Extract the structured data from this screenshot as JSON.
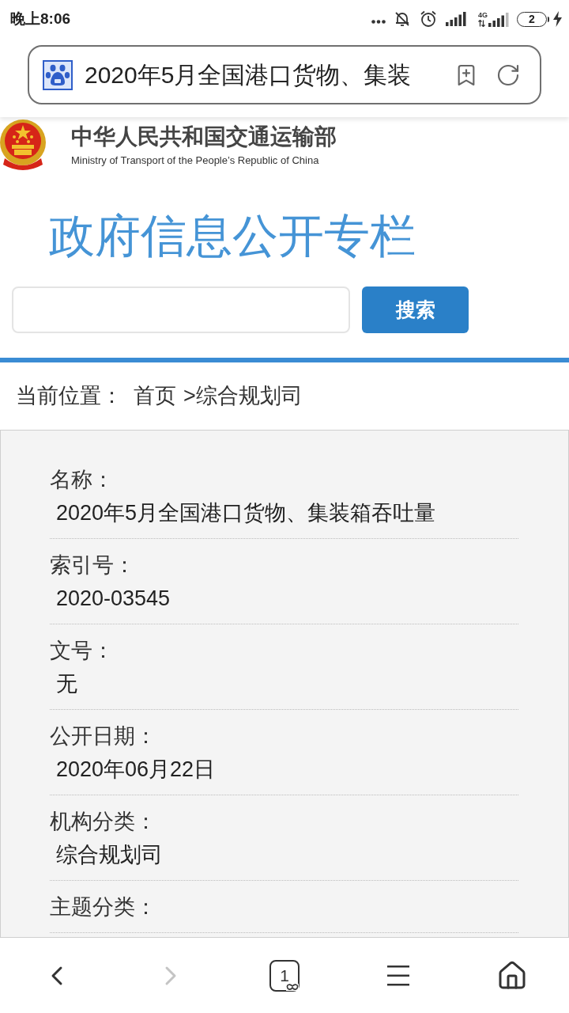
{
  "status_bar": {
    "time": "晚上8:06",
    "network_type": "4G",
    "battery": "2",
    "charging": true
  },
  "address_bar": {
    "title": "2020年5月全国港口货物、集装"
  },
  "site_header": {
    "title": "中华人民共和国交通运输部",
    "subtitle": "Ministry of Transport of the People’s Republic of China"
  },
  "section_title": "政府信息公开专栏",
  "search": {
    "button": "搜索"
  },
  "breadcrumb": {
    "label": "当前位置：",
    "items": [
      "首页",
      "综合规划司"
    ],
    "separator": ">"
  },
  "details": [
    {
      "label": "名称：",
      "value": "2020年5月全国港口货物、集装箱吞吐量"
    },
    {
      "label": "索引号：",
      "value": "2020-03545"
    },
    {
      "label": "文号：",
      "value": "无"
    },
    {
      "label": "公开日期：",
      "value": "2020年06月22日"
    },
    {
      "label": "机构分类：",
      "value": "综合规划司"
    },
    {
      "label": "主题分类："
    }
  ],
  "bottom_nav": [
    {
      "kind": "back",
      "disabled": false
    },
    {
      "kind": "forward",
      "disabled": true
    },
    {
      "kind": "tabs",
      "count": "1",
      "disabled": false
    },
    {
      "kind": "menu",
      "disabled": false
    },
    {
      "kind": "home",
      "disabled": false
    }
  ]
}
